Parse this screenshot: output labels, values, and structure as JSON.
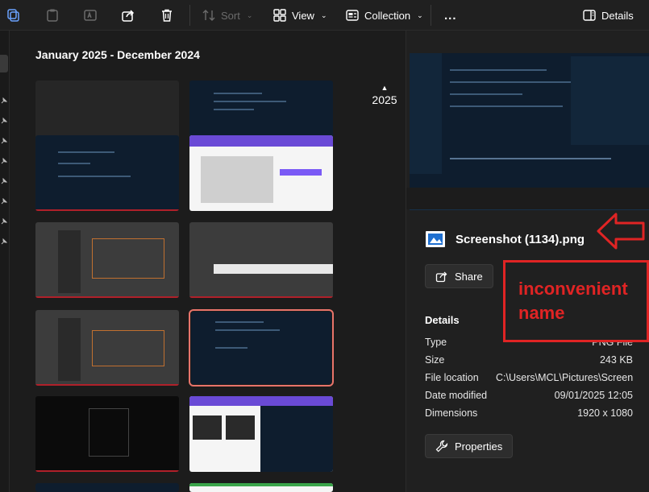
{
  "toolbar": {
    "sort_label": "Sort",
    "view_label": "View",
    "collection_label": "Collection",
    "more_label": "...",
    "details_label": "Details"
  },
  "gallery": {
    "title": "January 2025 - December 2024",
    "year_marker": "2025"
  },
  "details": {
    "file_name": "Screenshot (1134).png",
    "share_label": "Share",
    "section_title": "Details",
    "properties": [
      {
        "key": "Type",
        "value": "PNG File"
      },
      {
        "key": "Size",
        "value": "243 KB"
      },
      {
        "key": "File location",
        "value": "C:\\Users\\MCL\\Pictures\\Screen..."
      },
      {
        "key": "Date modified",
        "value": "09/01/2025 12:05"
      },
      {
        "key": "Dimensions",
        "value": "1920 x 1080"
      }
    ],
    "properties_label": "Properties"
  },
  "annotation": {
    "line1": "inconvenient",
    "line2": "name",
    "color": "#e02424"
  },
  "colors": {
    "accent_select": "#e8746a",
    "background": "#1c1c1c",
    "pane": "#202020"
  }
}
